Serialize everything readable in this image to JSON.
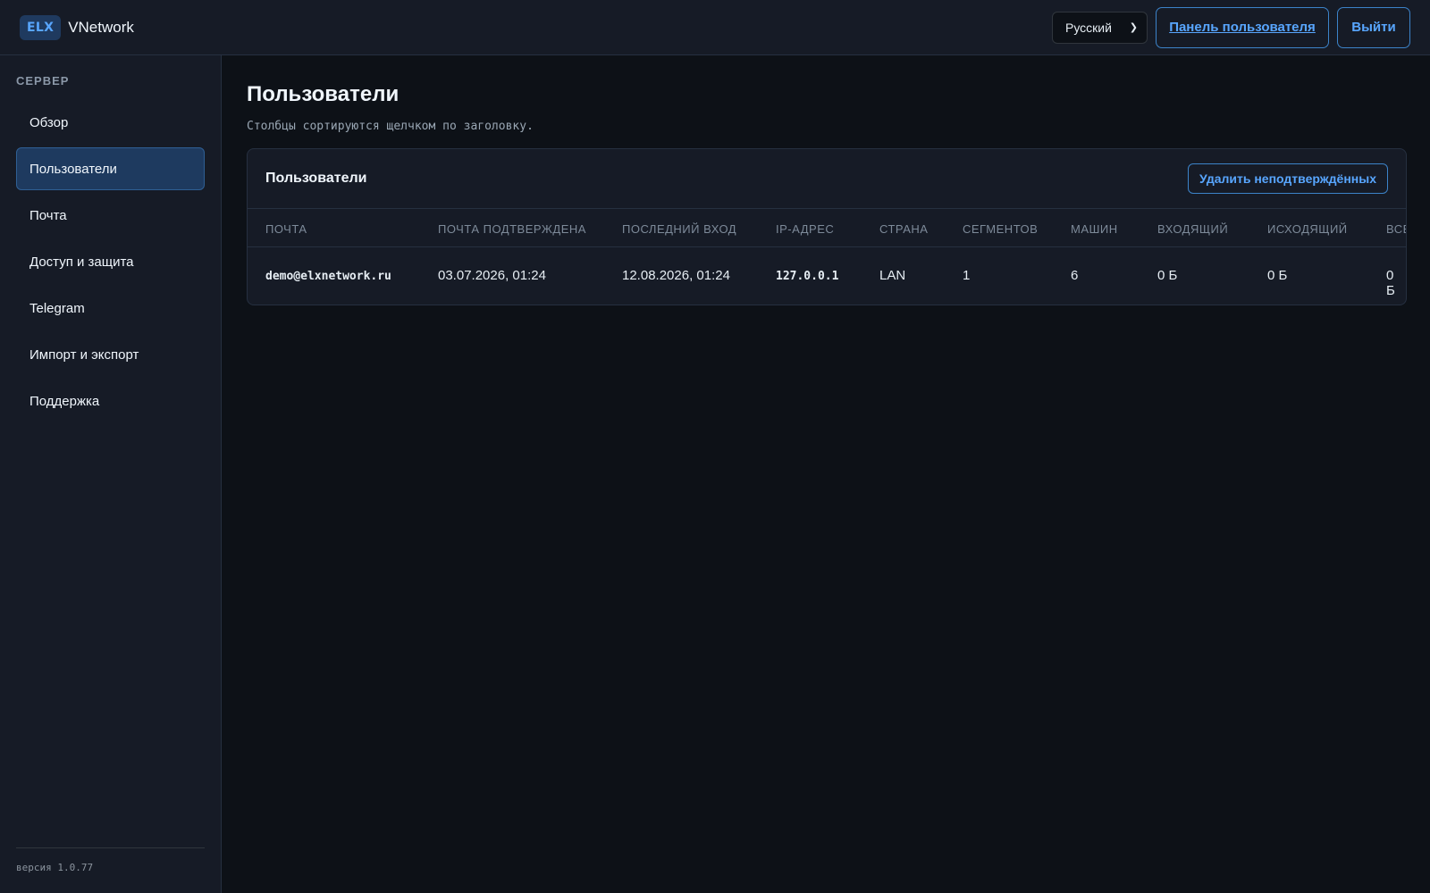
{
  "header": {
    "logo": "ELX",
    "brand": "VNetwork",
    "language": "Русский",
    "panel_button": "Панель пользователя",
    "logout_button": "Выйти"
  },
  "sidebar": {
    "heading": "СЕРВЕР",
    "items": [
      {
        "label": "Обзор",
        "active": false
      },
      {
        "label": "Пользователи",
        "active": true
      },
      {
        "label": "Почта",
        "active": false
      },
      {
        "label": "Доступ и защита",
        "active": false
      },
      {
        "label": "Telegram",
        "active": false
      },
      {
        "label": "Импорт и экспорт",
        "active": false
      },
      {
        "label": "Поддержка",
        "active": false
      }
    ],
    "version": "версия 1.0.77"
  },
  "main": {
    "title": "Пользователи",
    "subtitle": "Столбцы сортируются щелчком по заголовку.",
    "card": {
      "title": "Пользователи",
      "delete_button": "Удалить неподтверждённых",
      "columns": [
        "ПОЧТА",
        "ПОЧТА ПОДТВЕРЖДЕНА",
        "ПОСЛЕДНИЙ ВХОД",
        "IP-АДРЕС",
        "СТРАНА",
        "СЕГМЕНТОВ",
        "МАШИН",
        "ВХОДЯЩИЙ",
        "ИСХОДЯЩИЙ",
        "ВСЕ"
      ],
      "rows": [
        [
          "demo@elxnetwork.ru",
          "03.07.2026, 01:24",
          "12.08.2026, 01:24",
          "127.0.0.1",
          "LAN",
          "1",
          "6",
          "0 Б",
          "0 Б",
          "0 Б"
        ]
      ]
    }
  },
  "colors": {
    "background": "#0d1117",
    "surface": "#161b26",
    "accent": "#58a6ff",
    "active_item": "#1e3a5f"
  }
}
